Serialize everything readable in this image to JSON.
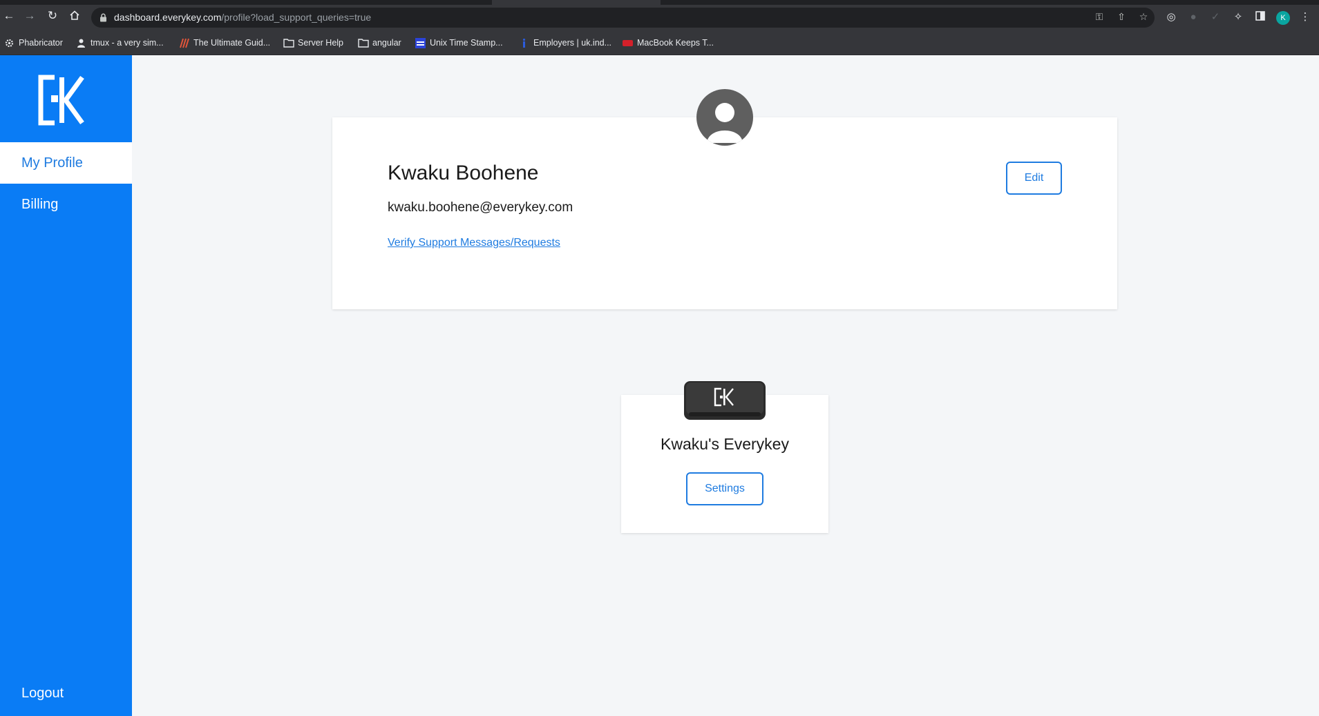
{
  "browser": {
    "url_host": "dashboard.everykey.com",
    "url_path": "/profile?load_support_queries=true",
    "profile_initial": "K",
    "bookmarks": [
      {
        "label": "Phabricator",
        "icon": "gear-icon"
      },
      {
        "label": "tmux - a very sim...",
        "icon": "person-icon"
      },
      {
        "label": "The Ultimate Guid...",
        "icon": "stripes-icon"
      },
      {
        "label": "Server Help",
        "icon": "folder-icon"
      },
      {
        "label": "angular",
        "icon": "folder-icon"
      },
      {
        "label": "Unix Time Stamp...",
        "icon": "date-icon"
      },
      {
        "label": "Employers | uk.ind...",
        "icon": "indeed-icon"
      },
      {
        "label": "MacBook Keeps T...",
        "icon": "site-icon"
      }
    ]
  },
  "sidebar": {
    "items": [
      {
        "label": "My Profile",
        "active": true
      },
      {
        "label": "Billing",
        "active": false
      }
    ],
    "logout_label": "Logout"
  },
  "profile": {
    "name": "Kwaku Boohene",
    "email": "kwaku.boohene@everykey.com",
    "support_link": "Verify Support Messages/Requests",
    "edit_label": "Edit"
  },
  "device": {
    "name": "Kwaku's Everykey",
    "settings_label": "Settings"
  },
  "colors": {
    "accent": "#0a7cf5",
    "link": "#1e7be0",
    "background": "#f4f6f8"
  }
}
